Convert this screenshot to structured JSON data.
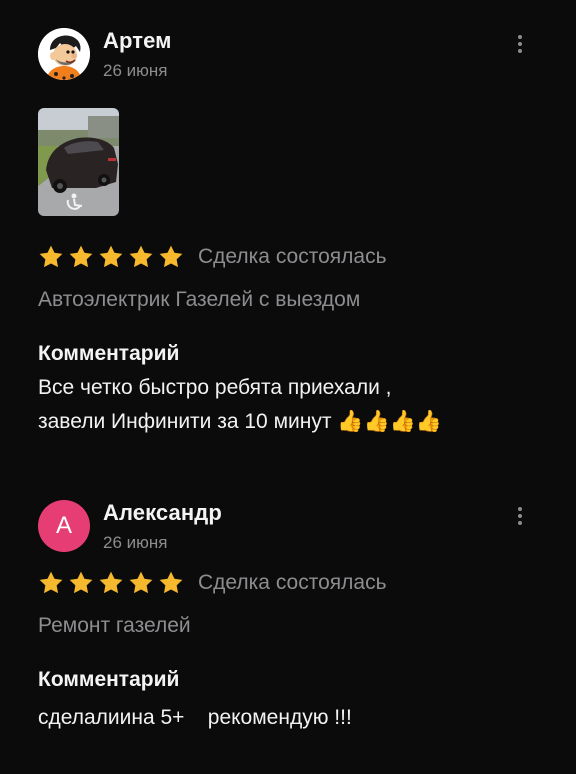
{
  "reviews": [
    {
      "author": "Артем",
      "date": "26 июня",
      "avatar_icon": "flintstone-cartoon-avatar",
      "has_photo": true,
      "photo_icon": "car-photo-thumbnail",
      "rating": 5,
      "rating_max": 5,
      "deal_status": "Сделка состоялась",
      "service": "Автоэлектрик Газелей с выездом",
      "comment_heading": "Комментарий",
      "comment_lines": [
        "Все четко быстро ребята приехали ,",
        "завели Инфинити за 10 минут 👍👍👍👍"
      ]
    },
    {
      "author": "Александр",
      "date": "26 июня",
      "avatar_letter": "А",
      "avatar_color": "#e63d75",
      "rating": 5,
      "rating_max": 5,
      "deal_status": "Сделка состоялась",
      "service": "Ремонт газелей",
      "comment_heading": "Комментарий",
      "comment_lines": [
        "сделалиина 5+    рекомендую !!!"
      ]
    }
  ],
  "colors": {
    "background": "#0b0b0c",
    "star": "#f6b82c",
    "muted_text": "#8d8d90",
    "primary_text": "#f4f4f4"
  },
  "icons": {
    "more": "more-vertical-icon",
    "star": "star-icon"
  }
}
